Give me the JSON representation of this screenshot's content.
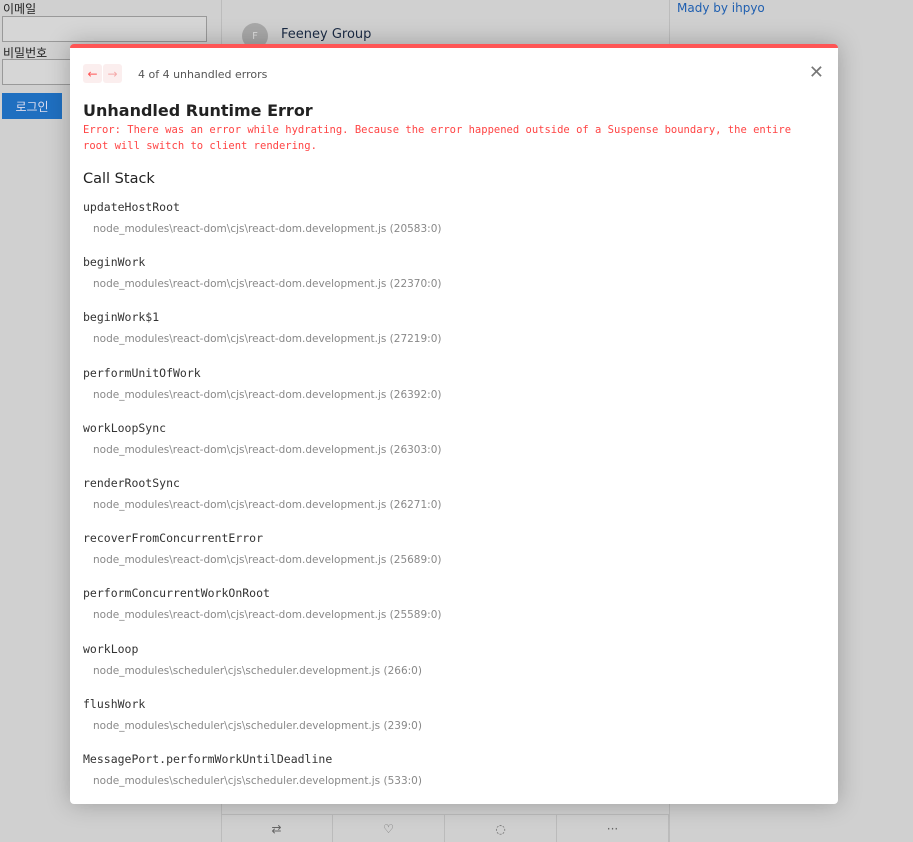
{
  "background": {
    "email_label": "이메일",
    "password_label": "비밀번호",
    "login_button": "로그인",
    "avatar_initial": "F",
    "group_name": "Feeney Group",
    "made_by": "Mady by ihpyo",
    "actions": [
      "⇄",
      "♡",
      "◌",
      "···"
    ]
  },
  "modal": {
    "accent": "#ff5555",
    "counter": "4 of 4 unhandled errors",
    "title": "Unhandled Runtime Error",
    "error": "Error: There was an error while hydrating. Because the error happened outside of a Suspense boundary, the entire root will switch to client rendering.",
    "call_stack_title": "Call Stack",
    "frames": [
      {
        "fn": "updateHostRoot",
        "loc": "node_modules\\react-dom\\cjs\\react-dom.development.js (20583:0)"
      },
      {
        "fn": "beginWork",
        "loc": "node_modules\\react-dom\\cjs\\react-dom.development.js (22370:0)"
      },
      {
        "fn": "beginWork$1",
        "loc": "node_modules\\react-dom\\cjs\\react-dom.development.js (27219:0)"
      },
      {
        "fn": "performUnitOfWork",
        "loc": "node_modules\\react-dom\\cjs\\react-dom.development.js (26392:0)"
      },
      {
        "fn": "workLoopSync",
        "loc": "node_modules\\react-dom\\cjs\\react-dom.development.js (26303:0)"
      },
      {
        "fn": "renderRootSync",
        "loc": "node_modules\\react-dom\\cjs\\react-dom.development.js (26271:0)"
      },
      {
        "fn": "recoverFromConcurrentError",
        "loc": "node_modules\\react-dom\\cjs\\react-dom.development.js (25689:0)"
      },
      {
        "fn": "performConcurrentWorkOnRoot",
        "loc": "node_modules\\react-dom\\cjs\\react-dom.development.js (25589:0)"
      },
      {
        "fn": "workLoop",
        "loc": "node_modules\\scheduler\\cjs\\scheduler.development.js (266:0)"
      },
      {
        "fn": "flushWork",
        "loc": "node_modules\\scheduler\\cjs\\scheduler.development.js (239:0)"
      },
      {
        "fn": "MessagePort.performWorkUntilDeadline",
        "loc": "node_modules\\scheduler\\cjs\\scheduler.development.js (533:0)"
      }
    ]
  }
}
